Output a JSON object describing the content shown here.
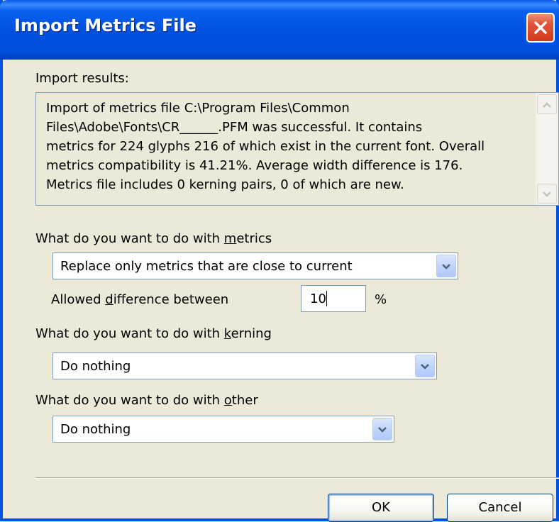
{
  "window": {
    "title": "Import Metrics File"
  },
  "results": {
    "label": "Import results:",
    "text": "Import of metrics file C:\\Program Files\\Common\nFiles\\Adobe\\Fonts\\CR______.PFM was successful. It contains\nmetrics for 224 glyphs 216 of which exist in the current font. Overall\nmetrics compatibility is 41.21%. Average width difference is 176.\nMetrics file includes 0 kerning pairs, 0 of which are new."
  },
  "metrics": {
    "label_before": "What do you want to do with ",
    "label_key": "m",
    "label_after": "etrics",
    "selected": "Replace only metrics that are close to current",
    "allowed_label_before": "Allowed ",
    "allowed_label_key": "d",
    "allowed_label_after": "ifference between",
    "allowed_value": "10",
    "allowed_unit": "%"
  },
  "kerning": {
    "label_before": "What do you want to do with ",
    "label_key": "k",
    "label_after": "erning",
    "selected": "Do nothing"
  },
  "other": {
    "label_before": "What do you want to do with ",
    "label_key": "o",
    "label_after": "ther",
    "selected": "Do nothing"
  },
  "buttons": {
    "ok": "OK",
    "cancel": "Cancel"
  },
  "icons": {
    "close": "close-icon",
    "scroll_up": "chevron-up-icon",
    "scroll_down": "chevron-down-icon",
    "dropdown": "chevron-down-icon"
  },
  "colors": {
    "titlebar": "#0054e3",
    "dialog_bg": "#ece9d8",
    "close_button": "#d23a1c",
    "combo_button": "#c2d5fb"
  }
}
